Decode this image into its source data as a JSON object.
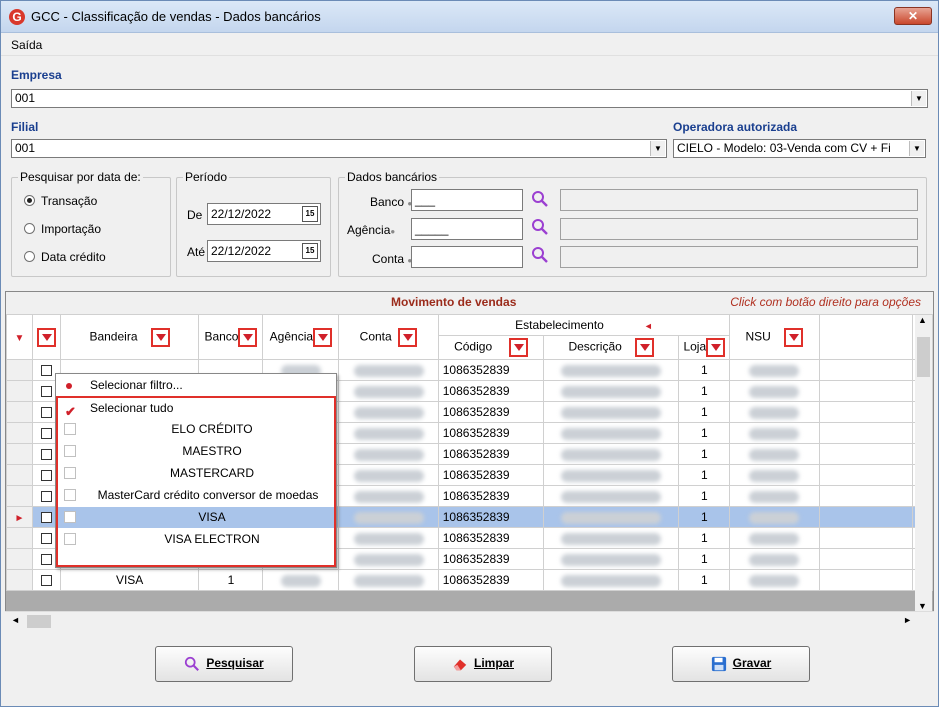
{
  "window": {
    "title": "GCC - Classificação de vendas - Dados bancários",
    "close_label": "✕"
  },
  "menu": {
    "saida": "Saída"
  },
  "empresa": {
    "label": "Empresa",
    "value": "001"
  },
  "filial": {
    "label": "Filial",
    "value": "001"
  },
  "operadora": {
    "label": "Operadora autorizada",
    "value": "CIELO - Modelo: 03-Venda com CV + Fi"
  },
  "pesquisar": {
    "legend": "Pesquisar por data de:",
    "options": [
      "Transação",
      "Importação",
      "Data crédito"
    ],
    "selected": "Transação"
  },
  "periodo": {
    "legend": "Período",
    "de_label": "De",
    "de_value": "22/12/2022",
    "ate_label": "Até",
    "ate_value": "22/12/2022",
    "cal_glyph": "15"
  },
  "dados_bancarios": {
    "legend": "Dados bancários",
    "banco_label": "Banco",
    "banco_value": "___",
    "agencia_label": "Agência",
    "agencia_value": "_____",
    "conta_label": "Conta",
    "conta_value": ""
  },
  "grid": {
    "title": "Movimento de vendas",
    "hint": "Click com botão direito para opções",
    "columns": {
      "bandeira": "Bandeira",
      "banco": "Banco",
      "agencia": "Agência",
      "conta": "Conta",
      "estabelecimento": "Estabelecimento",
      "codigo": "Código",
      "descricao": "Descrição",
      "loja": "Loja",
      "nsu": "NSU"
    },
    "rows": [
      {
        "bandeira": "",
        "banco": "",
        "codigo": "1086352839",
        "loja": "1"
      },
      {
        "bandeira": "",
        "banco": "",
        "codigo": "1086352839",
        "loja": "1"
      },
      {
        "bandeira": "",
        "banco": "",
        "codigo": "1086352839",
        "loja": "1"
      },
      {
        "bandeira": "",
        "banco": "",
        "codigo": "1086352839",
        "loja": "1"
      },
      {
        "bandeira": "",
        "banco": "",
        "codigo": "1086352839",
        "loja": "1"
      },
      {
        "bandeira": "",
        "banco": "",
        "codigo": "1086352839",
        "loja": "1"
      },
      {
        "bandeira": "",
        "banco": "",
        "codigo": "1086352839",
        "loja": "1"
      },
      {
        "bandeira": "",
        "banco": "",
        "codigo": "1086352839",
        "loja": "1"
      },
      {
        "bandeira": "VISA",
        "banco": "1",
        "codigo": "1086352839",
        "loja": "1"
      },
      {
        "bandeira": "VISA",
        "banco": "1",
        "codigo": "1086352839",
        "loja": "1"
      },
      {
        "bandeira": "VISA",
        "banco": "1",
        "codigo": "1086352839",
        "loja": "1"
      }
    ]
  },
  "filter_dropdown": {
    "select_filter": "Selecionar filtro...",
    "select_all": "Selecionar tudo",
    "items": [
      "ELO CRÉDITO",
      "MAESTRO",
      "MASTERCARD",
      "MasterCard crédito conversor de moedas",
      "VISA",
      "VISA ELECTRON"
    ]
  },
  "buttons": {
    "pesquisar": "Pesquisar",
    "limpar": "Limpar",
    "gravar": "Gravar"
  }
}
